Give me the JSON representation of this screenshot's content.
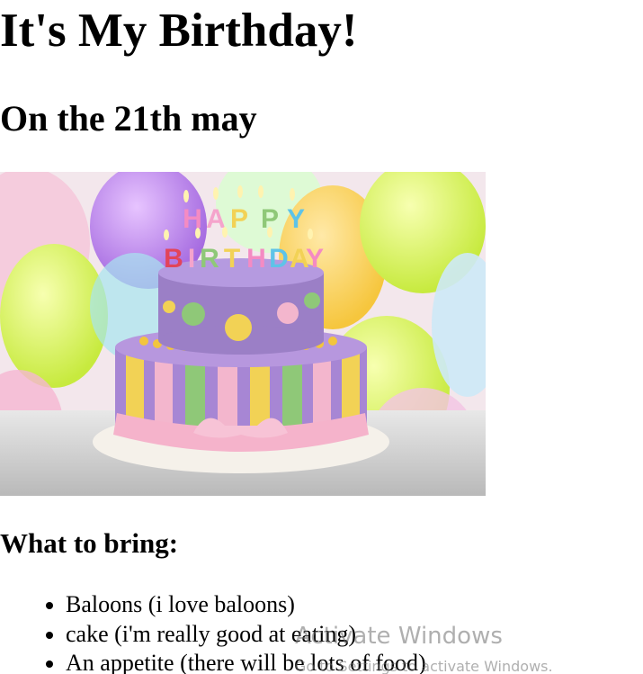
{
  "page": {
    "title": "It's My Birthday!",
    "subtitle": "On the 21th may",
    "image_alt": "HAPPY BIRTHDAY",
    "bring_heading": "What to bring:",
    "bring_items": [
      "Baloons (i love baloons)",
      "cake (i'm really good at eating)",
      "An appetite (there will be lots of food)"
    ]
  },
  "watermark": {
    "title": "Activate Windows",
    "subtitle": "Go to Settings to activate Windows."
  },
  "colors": {
    "text": "#000000",
    "background": "#ffffff",
    "cake_purple": "#9b7fc6",
    "cake_pink": "#f3b6cd",
    "cake_yellow": "#f2d255",
    "cake_green": "#8fc878"
  }
}
